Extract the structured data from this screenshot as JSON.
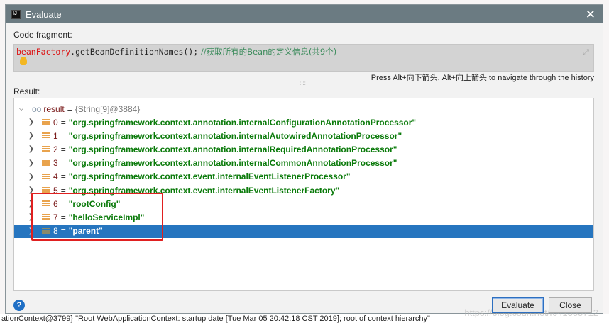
{
  "dialog": {
    "title": "Evaluate",
    "app_icon": "IJ"
  },
  "code_fragment": {
    "label": "Code fragment:",
    "receiver": "beanFactory",
    "call": ".getBeanDefinitionNames();",
    "comment": " //获取所有的Bean的定义信息(共9个)"
  },
  "history_hint": "Press Alt+向下箭头, Alt+向上箭头 to navigate through the history",
  "result": {
    "label": "Result:",
    "root_name": "result",
    "root_value": "{String[9]@3884}",
    "items": [
      {
        "index": "0",
        "value": "\"org.springframework.context.annotation.internalConfigurationAnnotationProcessor\""
      },
      {
        "index": "1",
        "value": "\"org.springframework.context.annotation.internalAutowiredAnnotationProcessor\""
      },
      {
        "index": "2",
        "value": "\"org.springframework.context.annotation.internalRequiredAnnotationProcessor\""
      },
      {
        "index": "3",
        "value": "\"org.springframework.context.annotation.internalCommonAnnotationProcessor\""
      },
      {
        "index": "4",
        "value": "\"org.springframework.context.event.internalEventListenerProcessor\""
      },
      {
        "index": "5",
        "value": "\"org.springframework.context.event.internalEventListenerFactory\""
      },
      {
        "index": "6",
        "value": "\"rootConfig\""
      },
      {
        "index": "7",
        "value": "\"helloServiceImpl\""
      },
      {
        "index": "8",
        "value": "\"parent\""
      }
    ]
  },
  "buttons": {
    "evaluate": "Evaluate",
    "close": "Close",
    "help": "?"
  },
  "background_text": "ationContext@3799} \"Root WebApplicationContext: startup date [Tue Mar 05 20:42:18 CST 2019]; root of context hierarchy\"",
  "watermark": "https://blog.csdn.net/f641385712"
}
